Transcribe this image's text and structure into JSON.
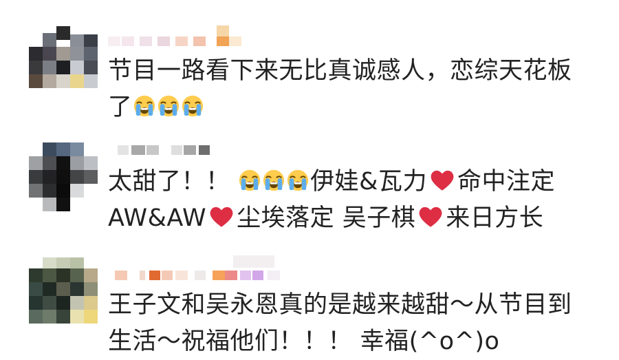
{
  "comments": [
    {
      "text_a": "节目一路看下来无比真诚感人，恋综天花板",
      "text_b": "了"
    },
    {
      "text_a": "太甜了！！",
      "text_b": "伊娃&瓦力",
      "text_c": "命中注定",
      "text_d": "AW&AW",
      "text_e": "尘埃落定 吴子棋",
      "text_f": "来日方长"
    },
    {
      "text_a": "王子文和吴永恩真的是越来越甜～从节目到",
      "text_b": "生活～祝福他们！！！ 幸福(^o^)o"
    }
  ],
  "icons": {
    "crying": "loudly-crying-face-emoji",
    "heart": "red-heart-emoji"
  },
  "colors": {
    "text": "#222222",
    "heart": "#dd2e44",
    "emoji_face": "#ffcc4d",
    "tears": "#5dadec"
  }
}
